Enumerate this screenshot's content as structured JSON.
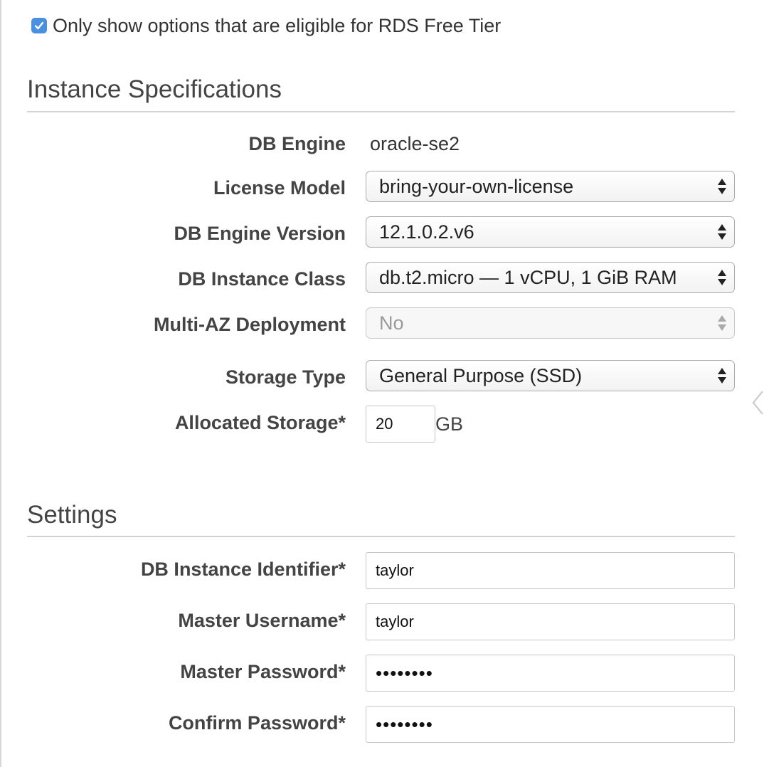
{
  "free_tier": {
    "checked": true,
    "label": "Only show options that are eligible for RDS Free Tier"
  },
  "instance_specs": {
    "title": "Instance Specifications",
    "db_engine": {
      "label": "DB Engine",
      "value": "oracle-se2"
    },
    "license_model": {
      "label": "License Model",
      "value": "bring-your-own-license"
    },
    "engine_version": {
      "label": "DB Engine Version",
      "value": "12.1.0.2.v6"
    },
    "instance_class": {
      "label": "DB Instance Class",
      "value": "db.t2.micro — 1 vCPU, 1 GiB RAM"
    },
    "multi_az": {
      "label": "Multi-AZ Deployment",
      "value": "No",
      "disabled": true
    },
    "storage_type": {
      "label": "Storage Type",
      "value": "General Purpose (SSD)"
    },
    "allocated_storage": {
      "label": "Allocated Storage*",
      "value": "20",
      "unit": "GB"
    }
  },
  "settings": {
    "title": "Settings",
    "instance_identifier": {
      "label": "DB Instance Identifier*",
      "value": "taylor"
    },
    "master_username": {
      "label": "Master Username*",
      "value": "taylor"
    },
    "master_password": {
      "label": "Master Password*",
      "value": "••••••••"
    },
    "confirm_password": {
      "label": "Confirm Password*",
      "value": "••••••••"
    }
  },
  "colors": {
    "checkbox_accent": "#4a90e2",
    "label_text": "#444444",
    "divider": "#d3d3d3"
  },
  "icons": {
    "checkbox": "checkmark-icon",
    "select_arrows": "up-down-arrows-icon",
    "side_panel": "chevron-left-icon"
  }
}
